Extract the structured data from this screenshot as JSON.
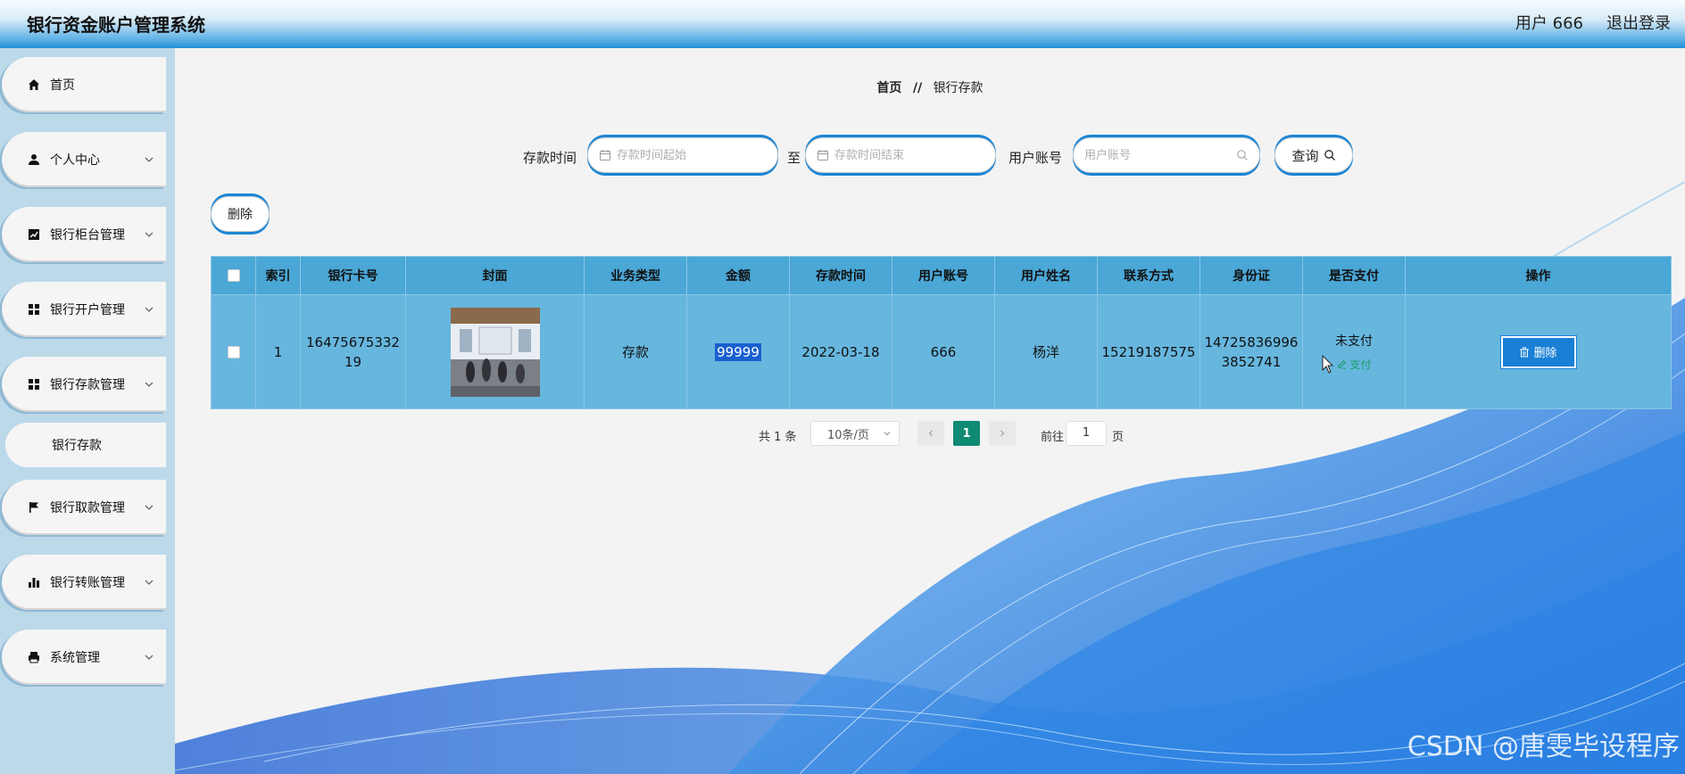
{
  "header": {
    "title": "银行资金账户管理系统",
    "user": "用户 666",
    "logout": "退出登录"
  },
  "sidebar": {
    "items": [
      {
        "label": "首页",
        "icon": "home-icon"
      },
      {
        "label": "个人中心",
        "icon": "user-icon"
      },
      {
        "label": "银行柜台管理",
        "icon": "chart-icon"
      },
      {
        "label": "银行开户管理",
        "icon": "grid-icon"
      },
      {
        "label": "银行存款管理",
        "icon": "grid-icon"
      },
      {
        "label": "银行取款管理",
        "icon": "flag-icon"
      },
      {
        "label": "银行转账管理",
        "icon": "bar-chart-icon"
      },
      {
        "label": "系统管理",
        "icon": "printer-icon"
      }
    ],
    "submenu": {
      "label": "银行存款"
    }
  },
  "breadcrumb": {
    "home": "首页",
    "separator": "//",
    "current": "银行存款"
  },
  "search": {
    "deposit_time_label": "存款时间",
    "start_placeholder": "存款时间起始",
    "to_label": "至",
    "end_placeholder": "存款时间结束",
    "account_label": "用户账号",
    "account_placeholder": "用户账号",
    "query_button": "查询"
  },
  "toolbar": {
    "delete_label": "删除"
  },
  "table": {
    "headers": [
      "索引",
      "银行卡号",
      "封面",
      "业务类型",
      "金额",
      "存款时间",
      "用户账号",
      "用户姓名",
      "联系方式",
      "身份证",
      "是否支付",
      "操作"
    ],
    "rows": [
      {
        "index": "1",
        "card": "16475675332\n19",
        "type": "存款",
        "amount": "99999",
        "time": "2022-03-18",
        "account": "666",
        "name": "杨洋",
        "phone": "15219187575",
        "id_card": "14725836996\n3852741",
        "paid": "未支付",
        "pay_action": "支付",
        "delete_label": "删除"
      }
    ]
  },
  "pagination": {
    "total": "共 1 条",
    "page_size": "10条/页",
    "current_page": "1",
    "goto_label": "前往",
    "goto_value": "1",
    "page_suffix": "页"
  },
  "watermark": "CSDN @唐雯毕设程序",
  "colors": {
    "accent": "#1a86d6",
    "table_header": "#4aa7d6",
    "table_row": "#66b6de",
    "active_page": "#0f8a73"
  }
}
